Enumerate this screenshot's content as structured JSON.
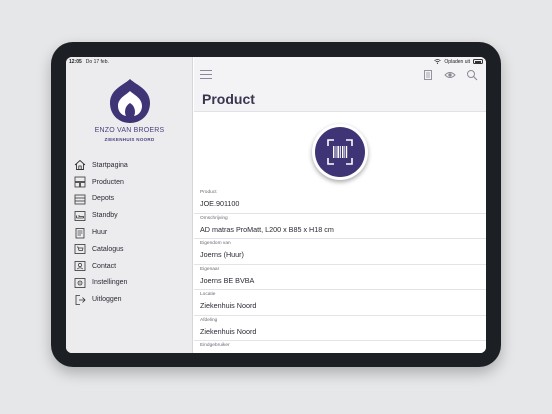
{
  "status": {
    "time": "12:05",
    "date": "Do 17 feb.",
    "carrier": "Opladen uit"
  },
  "brand": {
    "name": "ENZO VAN BROERS",
    "subtitle": "ZIEKENHUIS NOORD"
  },
  "menu": [
    {
      "label": "Startpagina",
      "icon": "home-icon"
    },
    {
      "label": "Producten",
      "icon": "boxes-icon"
    },
    {
      "label": "Depots",
      "icon": "depot-icon"
    },
    {
      "label": "Standby",
      "icon": "bed-icon"
    },
    {
      "label": "Huur",
      "icon": "clipboard-icon"
    },
    {
      "label": "Catalogus",
      "icon": "cart-icon"
    },
    {
      "label": "Contact",
      "icon": "contact-icon"
    },
    {
      "label": "Instellingen",
      "icon": "settings-icon"
    },
    {
      "label": "Uitloggen",
      "icon": "logout-icon"
    }
  ],
  "page": {
    "title": "Product"
  },
  "fields": [
    {
      "label": "Product",
      "value": "JOE.901100"
    },
    {
      "label": "Omschrijving",
      "value": "AD matras ProMatt, L200 x B85 x H18 cm"
    },
    {
      "label": "Eigendom van",
      "value": "Joerns (Huur)"
    },
    {
      "label": "Eigenaar",
      "value": "Joerns BE BVBA"
    },
    {
      "label": "Locatie",
      "value": "Ziekenhuis Noord"
    },
    {
      "label": "Afdeling",
      "value": "Ziekenhuis Noord"
    },
    {
      "label": "Eindgebruiker",
      "value": ""
    }
  ],
  "colors": {
    "accent": "#3f3475",
    "sidebar": "#ececef",
    "device": "#1c1f24"
  }
}
